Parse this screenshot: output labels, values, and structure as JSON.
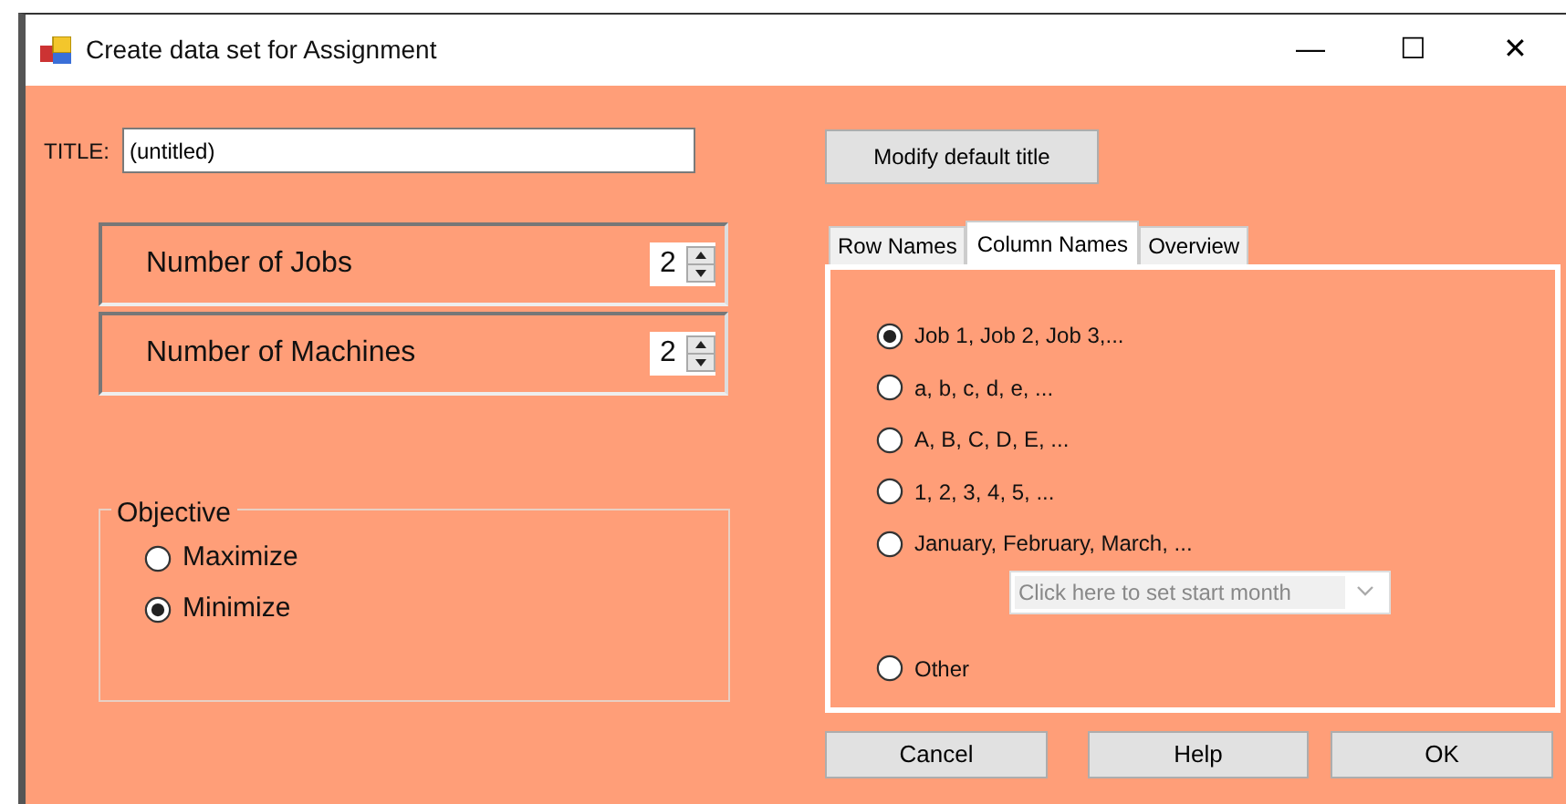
{
  "window": {
    "title": "Create data set for Assignment",
    "controls": [
      "—",
      "☐",
      "✕"
    ]
  },
  "title_field": {
    "label": "TITLE:",
    "value": "(untitled)"
  },
  "spinners": [
    {
      "label": "Number of Jobs",
      "value": "2"
    },
    {
      "label": "Number of Machines",
      "value": "2"
    }
  ],
  "objective": {
    "legend": "Objective",
    "options": [
      {
        "label": "Maximize",
        "selected": false
      },
      {
        "label": "Minimize",
        "selected": true
      }
    ]
  },
  "modify_button": "Modify default title",
  "tabs": [
    {
      "label": "Row Names",
      "selected": false
    },
    {
      "label": "Column Names",
      "selected": true
    },
    {
      "label": "Overview",
      "selected": false
    }
  ],
  "name_options": [
    {
      "label": "Job 1, Job 2, Job 3,...",
      "selected": true
    },
    {
      "label": "a, b, c, d, e, ...",
      "selected": false
    },
    {
      "label": "A, B, C, D, E, ...",
      "selected": false
    },
    {
      "label": "1, 2, 3, 4, 5, ...",
      "selected": false
    },
    {
      "label": "January, February, March, ...",
      "selected": false,
      "dropdown": {
        "placeholder": "Click here to set start month",
        "disabled": true
      }
    },
    {
      "label": "Other",
      "selected": false
    }
  ],
  "buttons": [
    "Cancel",
    "Help",
    "OK"
  ]
}
